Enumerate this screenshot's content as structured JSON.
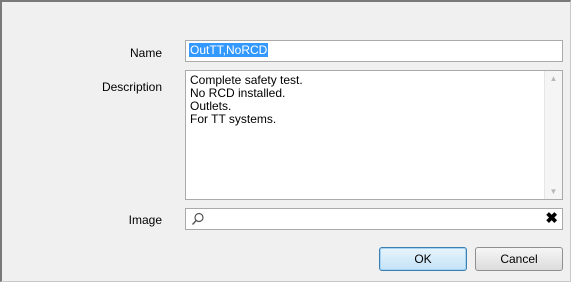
{
  "form": {
    "name_label": "Name",
    "name_value": "OutTT,NoRCD",
    "description_label": "Description",
    "description_lines": [
      "Complete safety test.",
      "No RCD installed.",
      "Outlets.",
      "For TT systems."
    ],
    "image_label": "Image",
    "image_value": "",
    "image_search_icon": "search-icon",
    "image_clear_icon": "clear-icon",
    "image_clear_glyph": "✖"
  },
  "buttons": {
    "ok_label": "OK",
    "cancel_label": "Cancel"
  },
  "colors": {
    "selection": "#3399ff",
    "ok_border": "#3c7fb1"
  }
}
